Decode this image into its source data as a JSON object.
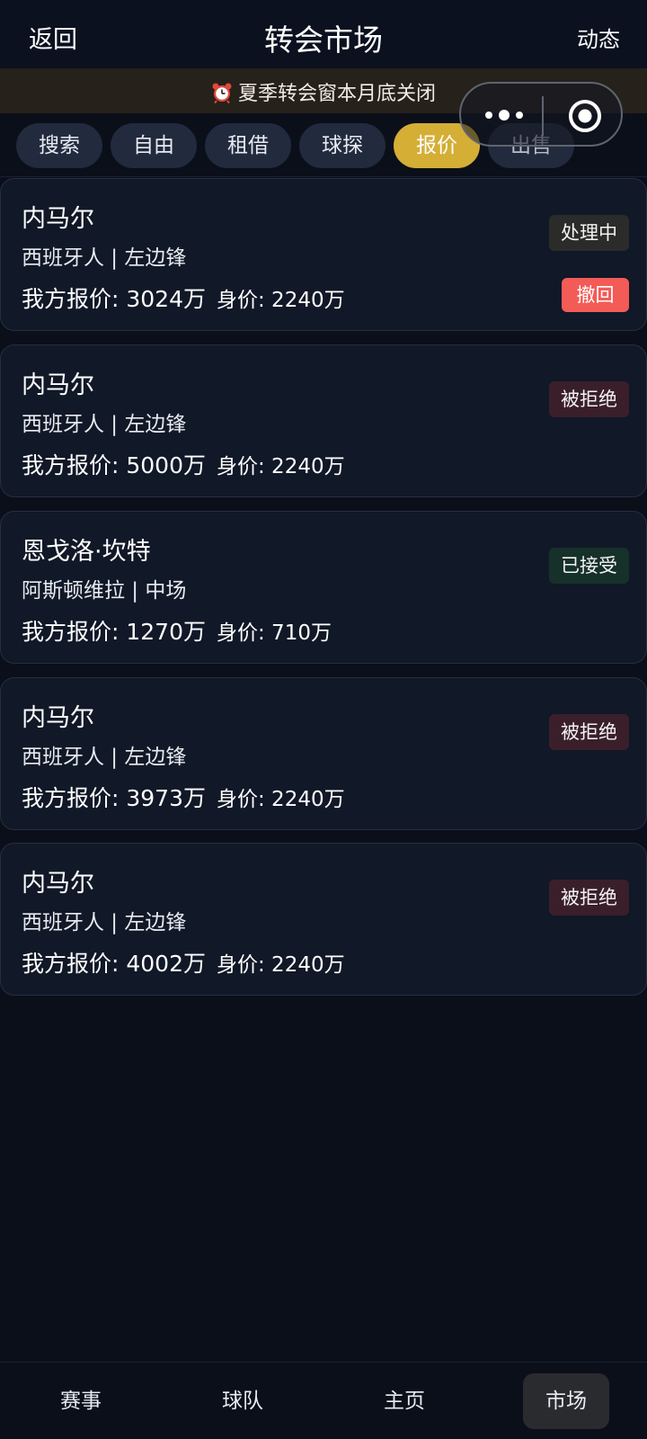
{
  "header": {
    "back_label": "返回",
    "title": "转会市场",
    "feed_label": "动态"
  },
  "notice": {
    "icon": "alarm-clock-icon",
    "text": "夏季转会窗本月底关闭"
  },
  "tabs": [
    {
      "label": "搜索",
      "active": false
    },
    {
      "label": "自由",
      "active": false
    },
    {
      "label": "租借",
      "active": false
    },
    {
      "label": "球探",
      "active": false
    },
    {
      "label": "报价",
      "active": true
    },
    {
      "label": "出售",
      "active": false
    }
  ],
  "offers": [
    {
      "name": "内马尔",
      "info": "西班牙人 | 左边锋",
      "offer": "我方报价: 3024万",
      "value": "身价: 2240万",
      "status": "处理中",
      "action": "撤回"
    },
    {
      "name": "内马尔",
      "info": "西班牙人 | 左边锋",
      "offer": "我方报价: 5000万",
      "value": "身价: 2240万",
      "status": "被拒绝"
    },
    {
      "name": "恩戈洛·坎特",
      "info": "阿斯顿维拉 | 中场",
      "offer": "我方报价: 1270万",
      "value": "身价: 710万",
      "status": "已接受"
    },
    {
      "name": "内马尔",
      "info": "西班牙人 | 左边锋",
      "offer": "我方报价: 3973万",
      "value": "身价: 2240万",
      "status": "被拒绝"
    },
    {
      "name": "内马尔",
      "info": "西班牙人 | 左边锋",
      "offer": "我方报价: 4002万",
      "value": "身价: 2240万",
      "status": "被拒绝"
    }
  ],
  "bottom_nav": [
    {
      "label": "赛事",
      "active": false
    },
    {
      "label": "球队",
      "active": false
    },
    {
      "label": "主页",
      "active": false
    },
    {
      "label": "市场",
      "active": true
    }
  ],
  "colors": {
    "background": "#0b0f1a",
    "card": "#111827",
    "accent": "#d4ae35",
    "withdraw": "#f35b57"
  }
}
